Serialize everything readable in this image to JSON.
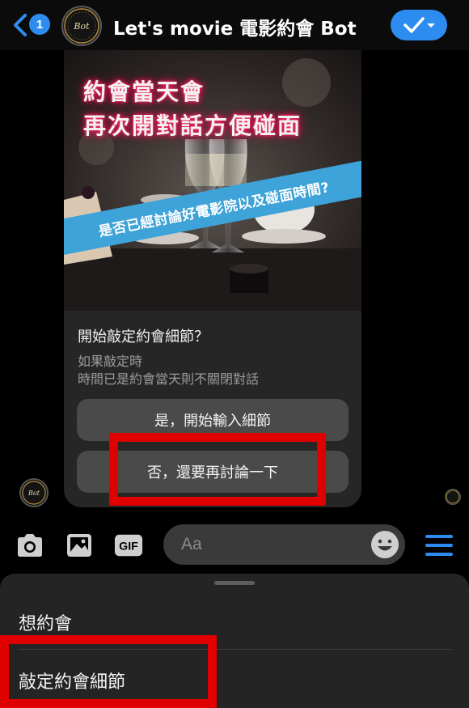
{
  "header": {
    "back_badge": "1",
    "title": "Let's movie 電影約會 Bot",
    "avatar_text": "Bot",
    "accent": "#2d8cf0"
  },
  "card": {
    "hero_line1": "約會當天會",
    "hero_line2": "再次開對話方便碰面",
    "banner_text": "是否已經討論好電影院以及碰面時間?",
    "title": "開始敲定約會細節？",
    "subtitle_line1": "如果敲定時",
    "subtitle_line2": "時間已是約會當天則不關閉對話",
    "buttons": [
      {
        "label": "是，開始輸入細節"
      },
      {
        "label": "否，還要再討論一下"
      }
    ]
  },
  "composer": {
    "gif_label": "GIF",
    "placeholder": "Aa"
  },
  "menu": {
    "items": [
      {
        "label": "想約會"
      },
      {
        "label": "敲定約會細節"
      }
    ]
  },
  "highlight_color": "#e00000"
}
